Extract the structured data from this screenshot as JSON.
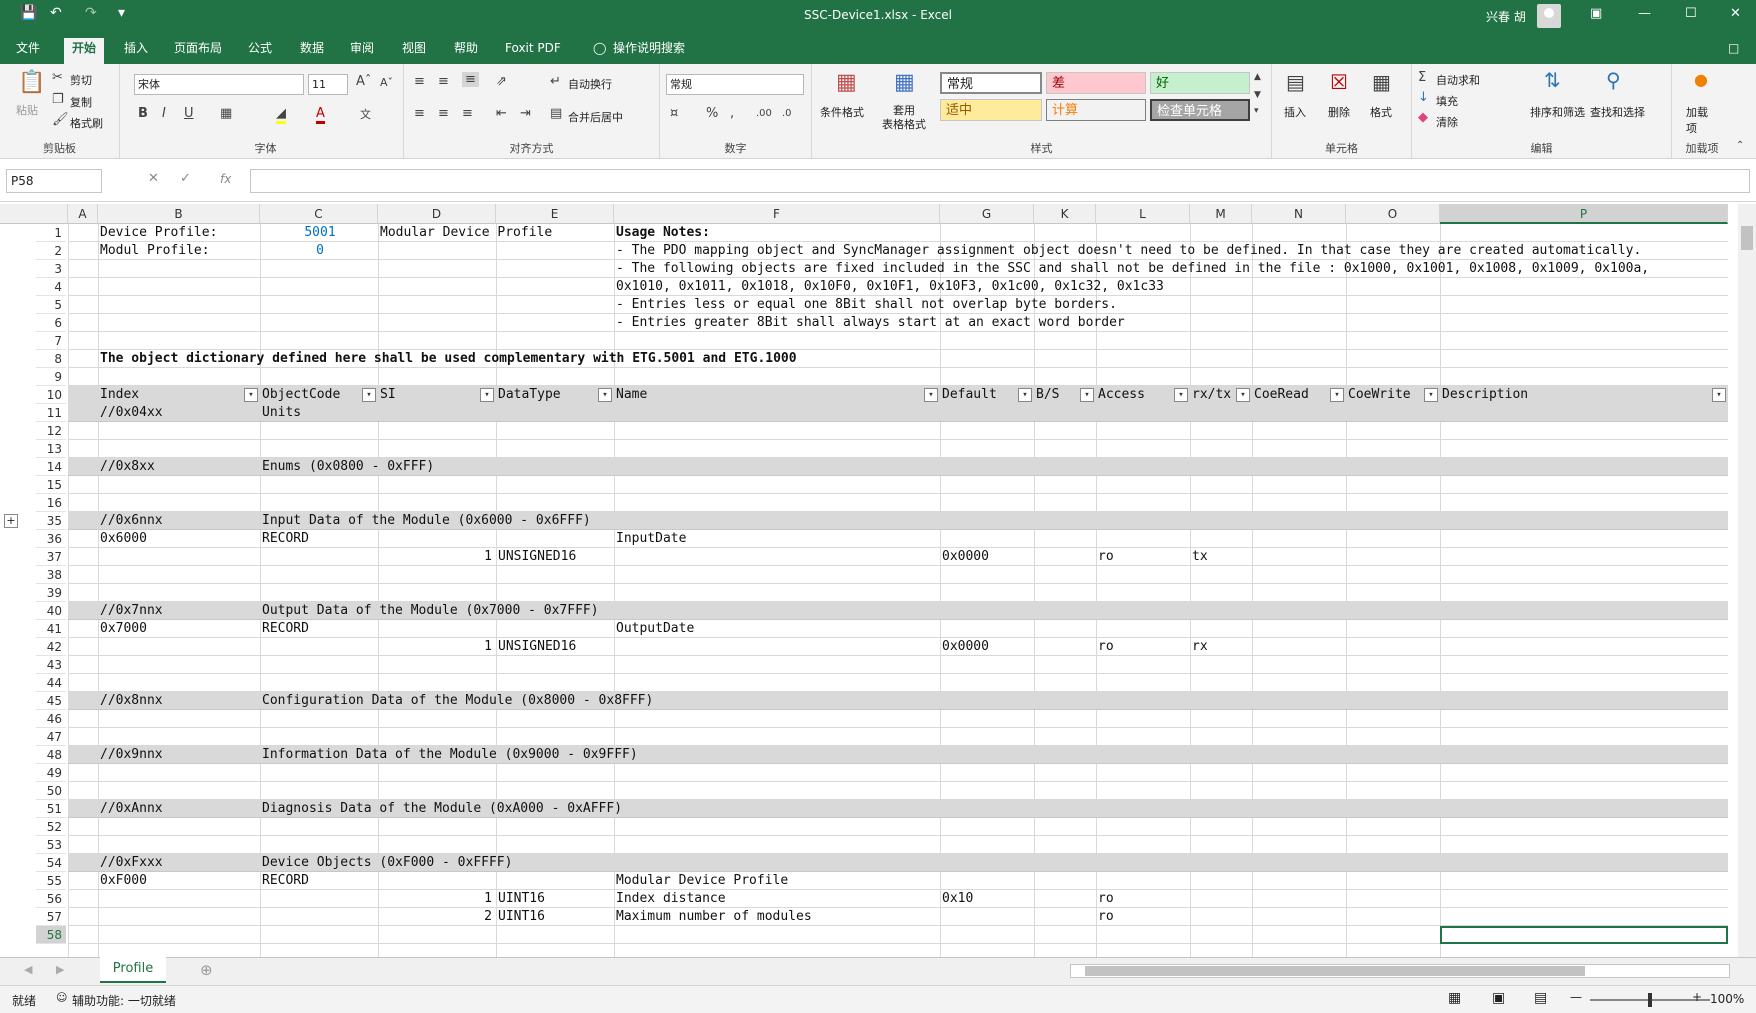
{
  "window": {
    "title": "SSC-Device1.xlsx  -  Excel",
    "user": "兴春 胡"
  },
  "menu": [
    "文件",
    "开始",
    "插入",
    "页面布局",
    "公式",
    "数据",
    "审阅",
    "视图",
    "帮助",
    "Foxit PDF",
    "操作说明搜索"
  ],
  "ribbon": {
    "clipboard": {
      "paste": "粘贴",
      "cut": "剪切",
      "copy": "复制",
      "format_painter": "格式刷",
      "label": "剪贴板"
    },
    "font": {
      "name": "宋体",
      "size": "11",
      "label": "字体"
    },
    "align": {
      "wrap": "自动换行",
      "merge": "合并后居中",
      "label": "对齐方式"
    },
    "number": {
      "format": "常规",
      "label": "数字"
    },
    "styles": {
      "cond": "条件格式",
      "table": "套用\n表格格式",
      "label": "样式",
      "normal": "常规",
      "bad": "差",
      "good": "好",
      "neutral": "适中",
      "calc": "计算",
      "check": "检查单元格"
    },
    "cells": {
      "insert": "插入",
      "delete": "删除",
      "format": "格式",
      "label": "单元格"
    },
    "editing": {
      "autosum": "自动求和",
      "fill": "填充",
      "clear": "清除",
      "sort": "排序和筛选",
      "find": "查找和选择",
      "label": "编辑"
    },
    "addins": {
      "addin": "加载项",
      "label": "加载项"
    }
  },
  "formula": {
    "namebox": "P58",
    "fx": "fx",
    "content": ""
  },
  "columns": [
    "A",
    "B",
    "C",
    "D",
    "E",
    "F",
    "G",
    "K",
    "L",
    "M",
    "N",
    "O",
    "P"
  ],
  "selected_column": "P",
  "selected_row": "58",
  "rows": [
    {
      "n": "1",
      "cells": {
        "B": "Device Profile:",
        "C": "5001",
        "D": "Modular Device Profile",
        "F": "Usage Notes:"
      }
    },
    {
      "n": "2",
      "cells": {
        "B": "Modul Profile:",
        "C": "0",
        "F": "- The PDO mapping object and SyncManager assignment object doesn't need to be defined. In that case they are created automatically."
      }
    },
    {
      "n": "3",
      "cells": {
        "F": "- The following objects are fixed included in the SSC and shall not be defined in the file : 0x1000, 0x1001, 0x1008, 0x1009, 0x100a,"
      }
    },
    {
      "n": "4",
      "cells": {
        "F": "0x1010, 0x1011, 0x1018, 0x10F0, 0x10F1, 0x10F3, 0x1c00, 0x1c32, 0x1c33"
      }
    },
    {
      "n": "5",
      "cells": {
        "F": "- Entries less or equal one 8Bit shall not overlap byte borders."
      }
    },
    {
      "n": "6",
      "cells": {
        "F": "- Entries greater 8Bit shall always start at an exact word border"
      }
    },
    {
      "n": "7",
      "cells": {}
    },
    {
      "n": "8",
      "cells": {
        "B": "The object dictionary defined here shall be used complementary with ETG.5001 and ETG.1000"
      }
    },
    {
      "n": "9",
      "cells": {}
    },
    {
      "n": "10",
      "header": true,
      "cells": {
        "B": "Index",
        "C": "ObjectCode",
        "D": "SI",
        "E": "DataType",
        "F": "Name",
        "G": "Default",
        "K": "B/S",
        "L": "Access",
        "M": "rx/tx",
        "N": "CoeRead",
        "O": "CoeWrite",
        "P": "Description"
      }
    },
    {
      "n": "11",
      "band": true,
      "cells": {
        "B": "//0x04xx",
        "C": "Units"
      }
    },
    {
      "n": "12",
      "cells": {}
    },
    {
      "n": "13",
      "cells": {}
    },
    {
      "n": "14",
      "band": true,
      "cells": {
        "B": "//0x8xx",
        "C": "Enums (0x0800 - 0xFFF)"
      }
    },
    {
      "n": "15",
      "cells": {}
    },
    {
      "n": "16",
      "cells": {}
    },
    {
      "n": "35",
      "band": true,
      "cells": {
        "B": "//0x6nnx",
        "C": "Input Data of the Module (0x6000 - 0x6FFF)"
      }
    },
    {
      "n": "36",
      "cells": {
        "B": "0x6000",
        "C": "RECORD",
        "F": "InputDate"
      }
    },
    {
      "n": "37",
      "cells": {
        "D": "1",
        "E": "UNSIGNED16",
        "G": "0x0000",
        "L": "ro",
        "M": "tx"
      }
    },
    {
      "n": "38",
      "cells": {}
    },
    {
      "n": "39",
      "cells": {}
    },
    {
      "n": "40",
      "band": true,
      "cells": {
        "B": "//0x7nnx",
        "C": "Output Data of the Module (0x7000 - 0x7FFF)"
      }
    },
    {
      "n": "41",
      "cells": {
        "B": "0x7000",
        "C": "RECORD",
        "F": "OutputDate"
      }
    },
    {
      "n": "42",
      "cells": {
        "D": "1",
        "E": "UNSIGNED16",
        "G": "0x0000",
        "L": "ro",
        "M": "rx"
      }
    },
    {
      "n": "43",
      "cells": {}
    },
    {
      "n": "44",
      "cells": {}
    },
    {
      "n": "45",
      "band": true,
      "cells": {
        "B": "//0x8nnx",
        "C": "Configuration Data of the Module (0x8000 - 0x8FFF)"
      }
    },
    {
      "n": "46",
      "cells": {}
    },
    {
      "n": "47",
      "cells": {}
    },
    {
      "n": "48",
      "band": true,
      "cells": {
        "B": "//0x9nnx",
        "C": "Information Data of the Module (0x9000 - 0x9FFF)"
      }
    },
    {
      "n": "49",
      "cells": {}
    },
    {
      "n": "50",
      "cells": {}
    },
    {
      "n": "51",
      "band": true,
      "cells": {
        "B": "//0xAnnx",
        "C": "Diagnosis Data of the Module (0xA000 - 0xAFFF)"
      }
    },
    {
      "n": "52",
      "cells": {}
    },
    {
      "n": "53",
      "cells": {}
    },
    {
      "n": "54",
      "band": true,
      "cells": {
        "B": "//0xFxxx",
        "C": "Device Objects (0xF000 - 0xFFFF)"
      }
    },
    {
      "n": "55",
      "cells": {
        "B": "0xF000",
        "C": "RECORD",
        "F": "Modular Device Profile"
      }
    },
    {
      "n": "56",
      "cells": {
        "D": "1",
        "E": "UINT16",
        "F": "Index distance",
        "G": "0x10",
        "L": "ro"
      }
    },
    {
      "n": "57",
      "cells": {
        "D": "2",
        "E": "UINT16",
        "F": "Maximum number of modules",
        "L": "ro"
      }
    },
    {
      "n": "58",
      "cells": {}
    }
  ],
  "sheet_tab": "Profile",
  "status": {
    "ready": "就绪",
    "accessibility": "辅助功能: 一切就绪",
    "zoom": "100%"
  }
}
